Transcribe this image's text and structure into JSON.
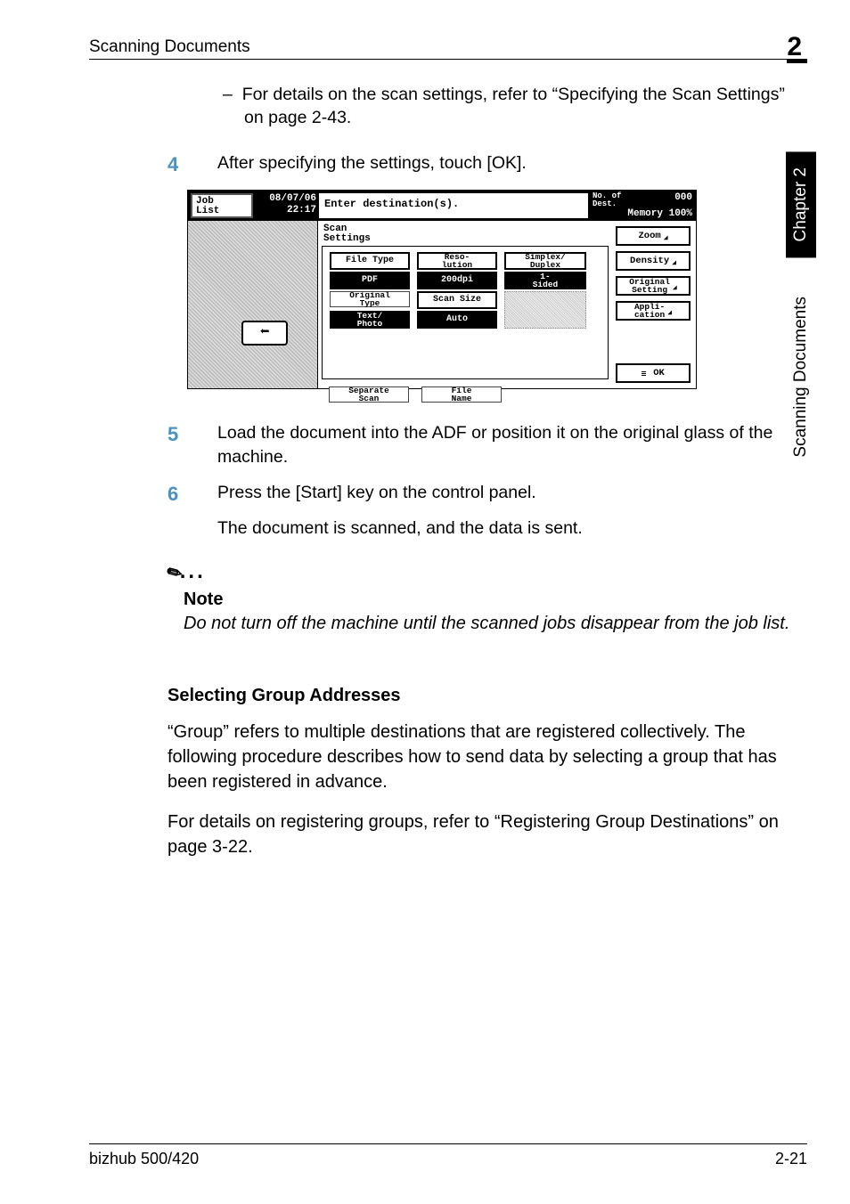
{
  "header": {
    "left": "Scanning Documents",
    "chapter_num": "2"
  },
  "side_tabs": {
    "chapter": "Chapter 2",
    "section": "Scanning Documents"
  },
  "footer": {
    "model": "bizhub 500/420",
    "page_num": "2-21"
  },
  "bullets": {
    "scan_settings_ref": "For details on the scan settings, refer to “Specifying the Scan Settings” on page 2-43."
  },
  "steps": {
    "s4_num": "4",
    "s4_text": "After specifying the settings, touch [OK].",
    "s5_num": "5",
    "s5_text": "Load the document into the ADF or position it on the original glass of the machine.",
    "s6_num": "6",
    "s6_text": "Press the [Start] key on the control panel.",
    "s6_result": "The document is scanned, and the data is sent."
  },
  "note": {
    "label": "Note",
    "body": "Do not turn off the machine until the scanned jobs disappear from the job list."
  },
  "section": {
    "heading": "Selecting Group Addresses",
    "p1": "“Group” refers to multiple destinations that are registered collectively. The following procedure describes how to send data by selecting a group that has been registered in advance.",
    "p2": "For details on registering groups, refer to “Registering Group Destinations” on page 3-22."
  },
  "lcd": {
    "job_list": "Job\nList",
    "date": "08/07/06",
    "time": "22:17",
    "prompt": "Enter destination(s).",
    "no_of_dest_label": "No. of\nDest.",
    "no_of_dest_value": "000",
    "memory_label": "Memory",
    "memory_value": "100%",
    "scan_settings_label": "Scan\nSettings",
    "file_type_label": "File Type",
    "file_type_value": "PDF",
    "resolution_label": "Reso-\nlution",
    "resolution_value": "200dpi",
    "simplex_label": "Simplex/\nDuplex",
    "simplex_value": "1-\nSided",
    "original_type_label": "Original\nType",
    "original_type_value": "Text/\nPhoto",
    "scan_size_label": "Scan Size",
    "scan_size_value": "Auto",
    "separate_scan_label": "Separate\nScan",
    "file_name_label": "File\nName",
    "zoom_label": "Zoom",
    "density_label": "Density",
    "original_setting_label": "Original\nSetting",
    "application_label": "Appli-\ncation",
    "ok_label": "OK",
    "arrow_glyph": "⬅"
  }
}
